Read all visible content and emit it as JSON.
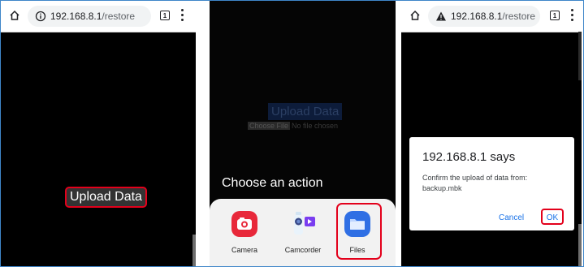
{
  "panels": {
    "left": {
      "url_host": "192.168.8.1",
      "url_path": "/restore",
      "tab_count": "1",
      "upload_button_label": "Upload Data"
    },
    "middle": {
      "background_title": "Upload Data",
      "file_button": "Choose File",
      "file_status": "No file chosen",
      "prompt": "Choose an action",
      "apps": [
        {
          "name": "Camera",
          "icon": "camera-icon",
          "color": "#e8283a"
        },
        {
          "name": "Camcorder",
          "icon": "camcorder-icon",
          "color": "#7a3df0"
        },
        {
          "name": "Files",
          "icon": "folder-icon",
          "color": "#2f6fe4"
        }
      ]
    },
    "right": {
      "url_host": "192.168.8.1",
      "url_path": "/restore",
      "tab_count": "1",
      "dialog_title": "192.168.8.1 says",
      "dialog_message": "Confirm the upload of data from: backup.mbk",
      "cancel_label": "Cancel",
      "ok_label": "OK"
    }
  },
  "colors": {
    "highlight": "#e3001b",
    "link_blue": "#1a73e8",
    "frame_blue": "#3f86c9"
  }
}
